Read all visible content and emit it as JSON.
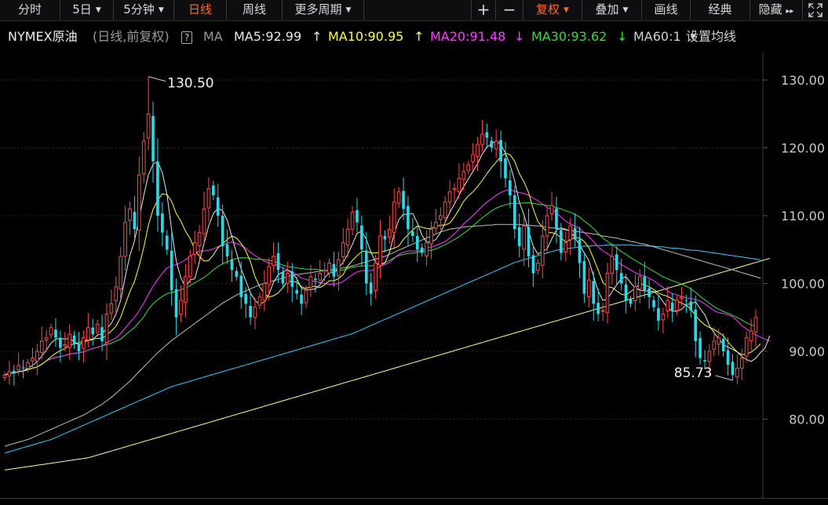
{
  "toolbar": {
    "tabs": [
      {
        "label": "分时"
      },
      {
        "label": "5日",
        "dropdown": true
      },
      {
        "label": "5分钟",
        "dropdown": true
      },
      {
        "label": "日线",
        "active": true
      },
      {
        "label": "周线"
      },
      {
        "label": "更多周期",
        "dropdown": true
      }
    ],
    "right_buttons": [
      {
        "label": "+"
      },
      {
        "label": "−"
      },
      {
        "label": "复权",
        "active": true,
        "dropdown": true
      },
      {
        "label": "叠加",
        "dropdown": true
      },
      {
        "label": "画线"
      },
      {
        "label": "经典"
      },
      {
        "label": "隐藏",
        "suffix": "▸▸"
      }
    ]
  },
  "legend": {
    "symbol": "NYMEX原油",
    "mode": "(日线,前复权)",
    "help": "?",
    "ma_label": "MA",
    "ma5": "MA5:92.99",
    "ma5_arrow": "↑",
    "ma10": "MA10:90.95",
    "ma10_arrow": "↑",
    "ma20": "MA20:91.48",
    "ma20_arrow": "↓",
    "ma30": "MA30:93.62",
    "ma30_arrow": "↓",
    "ma60": "MA60:1",
    "settings": "设置均线"
  },
  "colors": {
    "up": "#ff4a4a",
    "down": "#2bd8e8",
    "ma5": "#e8e8e8",
    "ma10": "#ffff3c",
    "ma20": "#ff3cff",
    "ma30": "#3cdc3c",
    "ma60": "#c0c0c0",
    "long_blue": "#3ad0ff",
    "long_yellow": "#ffffa0",
    "active_tab": "#ff6a2a",
    "axis_text": "#c8c8c8"
  },
  "chart_data": {
    "type": "candlestick",
    "y_ticks": [
      "130.00",
      "120.00",
      "110.00",
      "100.00",
      "90.00",
      "80.00"
    ],
    "ylim": [
      72,
      133
    ],
    "grid": "horizontal dotted",
    "annotations": {
      "high": "130.50",
      "low": "85.73"
    },
    "close": [
      86.5,
      87.0,
      86.8,
      87.9,
      87.5,
      88.3,
      89.0,
      90.0,
      91.5,
      92.0,
      93.5,
      92.0,
      90.5,
      91.0,
      92.5,
      91.0,
      90.0,
      92.0,
      93.5,
      92.5,
      94.0,
      91.5,
      95.5,
      97.0,
      99.5,
      104.0,
      109.0,
      111.0,
      108.0,
      116.0,
      121.0,
      125.0,
      118.0,
      110.0,
      107.5,
      105.0,
      99.0,
      95.0,
      97.5,
      101.0,
      104.0,
      106.0,
      107.5,
      111.0,
      114.0,
      113.0,
      110.0,
      105.5,
      104.0,
      102.0,
      101.0,
      98.0,
      97.0,
      95.0,
      96.5,
      98.0,
      100.0,
      102.5,
      104.0,
      102.0,
      100.0,
      101.5,
      99.5,
      98.5,
      97.0,
      99.0,
      101.0,
      100.5,
      101.5,
      102.0,
      103.0,
      101.0,
      103.5,
      106.0,
      108.0,
      110.5,
      109.0,
      105.0,
      100.0,
      98.5,
      103.0,
      107.0,
      106.5,
      108.0,
      112.0,
      113.5,
      111.0,
      108.0,
      107.0,
      105.0,
      104.5,
      106.0,
      108.0,
      109.0,
      110.0,
      112.0,
      113.5,
      114.0,
      115.5,
      116.5,
      117.5,
      119.0,
      120.5,
      122.0,
      121.5,
      120.0,
      121.0,
      118.0,
      115.5,
      113.0,
      108.0,
      105.5,
      108.5,
      104.0,
      101.5,
      103.0,
      107.0,
      110.0,
      111.5,
      108.0,
      104.5,
      106.0,
      108.5,
      106.5,
      103.0,
      98.5,
      100.5,
      97.0,
      95.5,
      96.0,
      101.5,
      104.0,
      102.0,
      100.0,
      97.5,
      97.0,
      99.5,
      101.0,
      99.0,
      98.0,
      96.5,
      94.5,
      95.5,
      97.5,
      96.0,
      97.5,
      98.0,
      97.5,
      96.0,
      91.5,
      89.0,
      88.5,
      90.0,
      91.5,
      92.0,
      90.0,
      88.0,
      86.5,
      87.5,
      89.0,
      92.0,
      93.0,
      95.0
    ],
    "ma5": [
      86.5,
      86.8,
      86.8,
      87.0,
      87.1,
      87.5,
      87.9,
      88.5,
      89.3,
      90.2,
      91.2,
      91.8,
      91.9,
      91.8,
      91.9,
      91.4,
      91.0,
      91.3,
      91.6,
      91.7,
      92.4,
      92.6,
      93.4,
      94.1,
      95.5,
      97.5,
      101.0,
      104.1,
      106.3,
      109.6,
      113.0,
      116.0,
      117.6,
      118.0,
      116.3,
      113.1,
      107.9,
      103.3,
      100.8,
      99.5,
      100.5,
      100.7,
      103.2,
      105.9,
      108.5,
      110.3,
      111.1,
      110.7,
      109.3,
      106.9,
      104.5,
      102.1,
      100.4,
      98.6,
      97.5,
      96.9,
      97.3,
      98.4,
      100.2,
      101.3,
      101.7,
      102.0,
      101.5,
      100.7,
      99.3,
      99.1,
      99.1,
      99.2,
      99.8,
      100.8,
      101.6,
      101.6,
      102.3,
      103.1,
      104.3,
      105.8,
      107.4,
      107.7,
      106.5,
      104.6,
      103.1,
      102.7,
      103.0,
      104.6,
      107.3,
      109.4,
      110.2,
      110.2,
      110.3,
      108.9,
      107.1,
      106.1,
      106.1,
      106.5,
      107.5,
      109.0,
      110.5,
      111.7,
      113.0,
      114.3,
      115.4,
      116.5,
      117.7,
      119.1,
      120.1,
      120.6,
      121.0,
      120.5,
      119.2,
      117.5,
      115.1,
      112.0,
      110.1,
      107.8,
      105.5,
      104.3,
      104.8,
      105.1,
      106.6,
      107.9,
      108.2,
      108.0,
      107.7,
      106.7,
      105.7,
      104.5,
      103.4,
      101.1,
      98.9,
      97.5,
      97.7,
      98.8,
      99.8,
      100.7,
      101.0,
      100.1,
      99.3,
      99.0,
      98.9,
      98.9,
      98.8,
      98.3,
      97.3,
      96.4,
      95.9,
      95.9,
      96.2,
      96.9,
      97.0,
      97.3,
      96.3,
      95.4,
      93.8,
      92.7,
      91.9,
      91.0,
      90.6,
      90.3,
      89.9,
      89.2,
      88.8,
      88.5,
      89.0,
      89.8,
      90.5,
      92.3
    ],
    "ma10": [
      86.5,
      86.8,
      86.8,
      87.0,
      87.1,
      87.3,
      87.5,
      87.7,
      88.1,
      88.6,
      89.2,
      89.7,
      90.1,
      90.4,
      90.9,
      91.1,
      91.3,
      91.5,
      91.7,
      91.8,
      91.9,
      91.9,
      92.4,
      93.0,
      93.7,
      95.0,
      96.9,
      98.8,
      100.3,
      102.6,
      105.3,
      108.6,
      110.9,
      112.3,
      113.2,
      113.1,
      112.1,
      110.3,
      109.2,
      107.7,
      106.6,
      105.0,
      104.0,
      103.3,
      103.4,
      104.2,
      105.3,
      105.8,
      106.5,
      107.0,
      106.7,
      105.9,
      104.8,
      103.2,
      101.0,
      99.5,
      98.5,
      98.0,
      98.2,
      98.6,
      99.4,
      100.3,
      100.3,
      100.2,
      99.5,
      99.3,
      99.5,
      99.6,
      99.4,
      99.8,
      100.4,
      100.4,
      100.7,
      101.3,
      102.6,
      103.4,
      104.1,
      104.7,
      104.8,
      104.5,
      104.5,
      104.6,
      104.8,
      105.0,
      105.2,
      105.5,
      106.5,
      107.2,
      107.9,
      108.5,
      108.3,
      108.1,
      108.1,
      108.4,
      108.6,
      108.6,
      108.9,
      109.8,
      110.9,
      112.1,
      112.9,
      113.5,
      114.3,
      115.2,
      116.2,
      117.1,
      117.9,
      118.7,
      119.2,
      119.0,
      118.0,
      116.2,
      115.0,
      113.4,
      111.0,
      109.1,
      108.3,
      107.5,
      107.5,
      107.3,
      106.7,
      106.1,
      106.4,
      106.8,
      106.7,
      106.2,
      105.3,
      103.7,
      102.0,
      100.2,
      99.5,
      99.4,
      98.9,
      98.4,
      98.3,
      98.8,
      99.3,
      100.0,
      99.8,
      99.5,
      99.1,
      98.6,
      98.3,
      98.1,
      97.7,
      97.4,
      97.1,
      96.8,
      96.2,
      95.3,
      94.5,
      93.9,
      93.5,
      93.2,
      92.8,
      92.3,
      91.4,
      90.6,
      89.9,
      89.5,
      89.6,
      89.9,
      90.4,
      91.1
    ],
    "ma20": [
      86.5,
      86.8,
      86.8,
      87.0,
      87.1,
      87.3,
      87.5,
      87.7,
      88.1,
      88.6,
      88.9,
      89.1,
      89.2,
      89.4,
      89.6,
      89.7,
      89.8,
      89.9,
      90.2,
      90.4,
      90.6,
      90.8,
      91.3,
      91.6,
      92.0,
      92.6,
      93.4,
      94.3,
      95.0,
      96.0,
      97.1,
      98.4,
      99.6,
      100.6,
      101.5,
      102.3,
      102.6,
      102.8,
      103.1,
      103.5,
      104.0,
      104.5,
      104.8,
      104.8,
      104.9,
      105.1,
      105.4,
      105.6,
      106.0,
      106.1,
      105.9,
      105.6,
      105.2,
      104.6,
      104.1,
      103.7,
      103.3,
      103.0,
      102.9,
      102.6,
      102.3,
      102.0,
      101.7,
      101.3,
      100.8,
      100.6,
      100.4,
      100.3,
      100.1,
      100.0,
      99.9,
      99.9,
      100.0,
      100.3,
      100.8,
      101.3,
      101.7,
      101.9,
      101.9,
      101.9,
      102.2,
      102.5,
      102.8,
      103.1,
      103.7,
      104.3,
      104.6,
      104.8,
      104.8,
      104.8,
      104.9,
      105.2,
      105.4,
      105.6,
      105.9,
      106.2,
      106.7,
      107.3,
      108.0,
      108.8,
      109.4,
      110.0,
      110.7,
      111.4,
      112.0,
      112.5,
      113.0,
      113.4,
      113.7,
      113.8,
      113.6,
      113.4,
      113.3,
      113.0,
      112.6,
      112.2,
      111.7,
      111.2,
      110.9,
      110.4,
      109.8,
      109.2,
      108.8,
      108.5,
      108.1,
      107.5,
      106.9,
      106.2,
      105.4,
      104.8,
      104.4,
      103.9,
      103.3,
      102.8,
      102.4,
      102.0,
      101.6,
      101.3,
      101.1,
      100.8,
      100.4,
      99.9,
      99.4,
      98.9,
      98.5,
      98.3,
      98.1,
      97.9,
      97.8,
      97.6,
      97.4,
      97.0,
      96.5,
      96.0,
      95.7,
      95.6,
      95.4,
      95.1,
      94.5,
      93.8,
      93.3,
      92.8,
      92.4,
      92.1,
      91.8,
      91.5
    ],
    "ma30": [
      86.5,
      86.8,
      86.8,
      87.0,
      87.1,
      87.3,
      87.5,
      87.7,
      88.1,
      88.6,
      88.9,
      89.1,
      89.2,
      89.4,
      89.6,
      89.7,
      89.8,
      89.9,
      90.2,
      90.4,
      90.6,
      90.8,
      91.0,
      91.2,
      91.5,
      91.8,
      92.4,
      93.0,
      93.5,
      94.3,
      95.1,
      96.2,
      97.0,
      97.6,
      98.1,
      98.5,
      98.7,
      98.8,
      99.1,
      99.3,
      99.7,
      100.1,
      100.5,
      100.9,
      101.4,
      102.0,
      102.5,
      102.9,
      103.2,
      103.5,
      103.7,
      103.8,
      103.8,
      103.7,
      103.6,
      103.6,
      103.5,
      103.4,
      103.3,
      103.0,
      102.7,
      102.5,
      102.4,
      102.3,
      102.2,
      102.1,
      102.1,
      102.1,
      102.0,
      101.9,
      101.9,
      101.8,
      101.9,
      102.0,
      102.2,
      102.4,
      102.5,
      102.6,
      102.6,
      102.6,
      102.7,
      102.9,
      103.1,
      103.4,
      103.8,
      104.1,
      104.3,
      104.4,
      104.5,
      104.6,
      104.7,
      104.8,
      104.9,
      105.1,
      105.4,
      105.7,
      106.1,
      106.5,
      106.9,
      107.4,
      107.9,
      108.5,
      109.1,
      109.7,
      110.2,
      110.7,
      111.1,
      111.4,
      111.6,
      111.8,
      111.8,
      111.8,
      111.9,
      111.9,
      111.8,
      111.7,
      111.6,
      111.5,
      111.4,
      111.2,
      111.0,
      110.7,
      110.5,
      110.2,
      109.8,
      109.2,
      108.7,
      108.1,
      107.4,
      106.7,
      106.2,
      105.7,
      105.2,
      104.7,
      104.3,
      103.8,
      103.4,
      103.0,
      102.6,
      102.2,
      101.8,
      101.4,
      101.0,
      100.7,
      100.4,
      100.2,
      99.9,
      99.6,
      99.2,
      98.7,
      98.1,
      97.6,
      97.1,
      96.6,
      96.2,
      95.9,
      95.6,
      95.3,
      95.0,
      94.6,
      94.2,
      93.9,
      93.7
    ],
    "ma60": [
      76.0,
      76.2,
      76.4,
      76.6,
      76.8,
      77.0,
      77.3,
      77.6,
      77.9,
      78.2,
      78.5,
      78.8,
      79.1,
      79.4,
      79.7,
      80.0,
      80.3,
      80.6,
      81.0,
      81.4,
      81.8,
      82.2,
      82.7,
      83.2,
      83.8,
      84.4,
      85.0,
      85.6,
      86.3,
      87.0,
      87.7,
      88.4,
      89.1,
      89.8,
      90.4,
      91.0,
      91.6,
      92.1,
      92.6,
      93.1,
      93.6,
      94.1,
      94.6,
      95.1,
      95.6,
      96.1,
      96.6,
      97.1,
      97.5,
      97.9,
      98.3,
      98.6,
      98.9,
      99.2,
      99.5,
      99.8,
      100.0,
      100.2,
      100.4,
      100.6,
      100.8,
      101.0,
      101.2,
      101.3,
      101.4,
      101.5,
      101.6,
      101.7,
      101.8,
      101.9,
      102.0,
      102.1,
      102.2,
      102.3,
      102.4,
      102.6,
      102.8,
      103.0,
      103.2,
      103.4,
      103.6,
      103.8,
      104.0,
      104.3,
      104.6,
      104.9,
      105.2,
      105.5,
      105.8,
      106.1,
      106.4,
      106.7,
      107.0,
      107.3,
      107.6,
      107.8,
      108.0,
      108.1,
      108.2,
      108.3,
      108.4,
      108.4,
      108.5,
      108.5,
      108.6,
      108.6,
      108.7,
      108.7,
      108.7,
      108.7,
      108.7,
      108.7,
      108.6,
      108.6,
      108.5,
      108.5,
      108.4,
      108.3,
      108.2,
      108.1,
      108.0,
      107.9,
      107.8,
      107.7,
      107.6,
      107.5,
      107.4,
      107.3,
      107.2,
      107.0,
      106.9,
      106.8,
      106.7,
      106.5,
      106.4,
      106.2,
      106.1,
      105.9,
      105.8,
      105.6,
      105.4,
      105.2,
      105.0,
      104.8,
      104.6,
      104.4,
      104.2,
      104.0,
      103.8,
      103.6,
      103.4,
      103.2,
      103.0,
      102.8,
      102.6,
      102.4,
      102.2,
      102.0,
      101.8,
      101.6,
      101.4,
      101.2,
      101.0,
      100.8
    ],
    "ma_blue": [
      75.0,
      75.2,
      75.4,
      75.6,
      75.8,
      76.0,
      76.2,
      76.4,
      76.6,
      76.8,
      77.0,
      77.3,
      77.6,
      77.9,
      78.2,
      78.5,
      78.8,
      79.1,
      79.4,
      79.7,
      80.0,
      80.3,
      80.6,
      80.9,
      81.2,
      81.5,
      81.8,
      82.1,
      82.4,
      82.7,
      83.0,
      83.3,
      83.6,
      83.9,
      84.2,
      84.5,
      84.8,
      85.0,
      85.2,
      85.4,
      85.6,
      85.8,
      86.0,
      86.2,
      86.4,
      86.6,
      86.8,
      87.0,
      87.2,
      87.4,
      87.6,
      87.8,
      88.0,
      88.2,
      88.4,
      88.6,
      88.8,
      89.0,
      89.2,
      89.4,
      89.6,
      89.8,
      90.0,
      90.2,
      90.4,
      90.6,
      90.8,
      91.0,
      91.2,
      91.4,
      91.6,
      91.8,
      92.0,
      92.2,
      92.4,
      92.6,
      92.9,
      93.2,
      93.5,
      93.8,
      94.1,
      94.4,
      94.7,
      95.0,
      95.3,
      95.6,
      95.9,
      96.2,
      96.5,
      96.8,
      97.1,
      97.4,
      97.7,
      98.0,
      98.3,
      98.6,
      98.9,
      99.2,
      99.5,
      99.8,
      100.1,
      100.4,
      100.7,
      101.0,
      101.3,
      101.6,
      101.9,
      102.2,
      102.5,
      102.8,
      103.1,
      103.3,
      103.5,
      103.7,
      103.9,
      104.1,
      104.3,
      104.5,
      104.7,
      104.9,
      105.0,
      105.1,
      105.2,
      105.3,
      105.4,
      105.5,
      105.5,
      105.6,
      105.6,
      105.6,
      105.7,
      105.7,
      105.7,
      105.7,
      105.7,
      105.7,
      105.6,
      105.6,
      105.6,
      105.5,
      105.5,
      105.4,
      105.4,
      105.3,
      105.2,
      105.2,
      105.1,
      105.0,
      104.9,
      104.9,
      104.8,
      104.7,
      104.6,
      104.5,
      104.4,
      104.3,
      104.2,
      104.1,
      104.0,
      103.9,
      103.8,
      103.7,
      103.6,
      103.5
    ],
    "ma_yellow": [
      72.5,
      72.6,
      72.7,
      72.8,
      72.9,
      73.0,
      73.1,
      73.2,
      73.3,
      73.4,
      73.5,
      73.6,
      73.7,
      73.8,
      73.9,
      74.0,
      74.1,
      74.2,
      74.3,
      74.5,
      74.7,
      74.9,
      75.1,
      75.3,
      75.5,
      75.7,
      75.9,
      76.1,
      76.3,
      76.5,
      76.7,
      76.9,
      77.1,
      77.3,
      77.5,
      77.7,
      77.9,
      78.1,
      78.3,
      78.5,
      78.7,
      78.9,
      79.1,
      79.3,
      79.5,
      79.7,
      79.9,
      80.1,
      80.3,
      80.5,
      80.7,
      80.9,
      81.1,
      81.3,
      81.5,
      81.7,
      81.9,
      82.1,
      82.3,
      82.5,
      82.7,
      82.9,
      83.1,
      83.3,
      83.5,
      83.7,
      83.9,
      84.1,
      84.3,
      84.5,
      84.7,
      84.9,
      85.1,
      85.3,
      85.5,
      85.7,
      85.9,
      86.1,
      86.3,
      86.5,
      86.7,
      86.9,
      87.1,
      87.3,
      87.5,
      87.7,
      87.9,
      88.1,
      88.3,
      88.5,
      88.7,
      88.9,
      89.1,
      89.3,
      89.5,
      89.7,
      89.9,
      90.1,
      90.3,
      90.5,
      90.7,
      90.9,
      91.1,
      91.3,
      91.5,
      91.7,
      91.9,
      92.1,
      92.3,
      92.5,
      92.7,
      92.9,
      93.1,
      93.3,
      93.5,
      93.7,
      93.9,
      94.1,
      94.3,
      94.5,
      94.7,
      94.9,
      95.1,
      95.3,
      95.5,
      95.7,
      95.9,
      96.1,
      96.3,
      96.5,
      96.7,
      96.9,
      97.1,
      97.3,
      97.5,
      97.7,
      97.9,
      98.1,
      98.3,
      98.5,
      98.7,
      98.9,
      99.1,
      99.3,
      99.5,
      99.7,
      99.9,
      100.1,
      100.3,
      100.5,
      100.7,
      100.9,
      101.1,
      101.3,
      101.5,
      101.7,
      101.9,
      102.1,
      102.3,
      102.5,
      102.7,
      102.9,
      103.1,
      103.3,
      103.5,
      103.7
    ]
  }
}
